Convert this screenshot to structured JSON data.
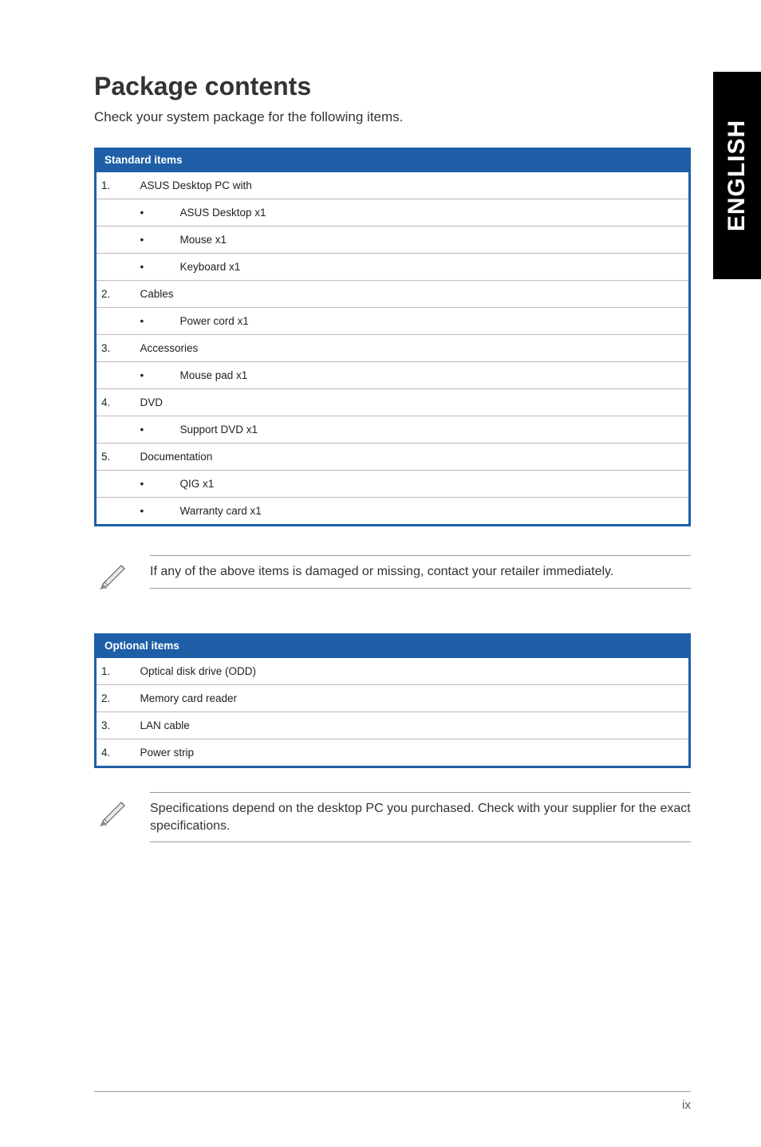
{
  "sideTab": "ENGLISH",
  "title": "Package contents",
  "intro": "Check your system package for the following items.",
  "standard": {
    "header": "Standard items",
    "rows": [
      {
        "n": "1.",
        "label": "ASUS Desktop PC with"
      },
      {
        "bullet": "•",
        "sub": "ASUS Desktop x1"
      },
      {
        "bullet": "•",
        "sub": "Mouse x1"
      },
      {
        "bullet": "•",
        "sub": "Keyboard x1"
      },
      {
        "n": "2.",
        "label": "Cables"
      },
      {
        "bullet": "•",
        "sub": "Power cord x1"
      },
      {
        "n": "3.",
        "label": "Accessories"
      },
      {
        "bullet": "•",
        "sub": "Mouse pad x1"
      },
      {
        "n": "4.",
        "label": "DVD"
      },
      {
        "bullet": "•",
        "sub": "Support DVD x1"
      },
      {
        "n": "5.",
        "label": "Documentation"
      },
      {
        "bullet": "•",
        "sub": "QIG x1"
      },
      {
        "bullet": "•",
        "sub": "Warranty card x1"
      }
    ]
  },
  "note1": "If any of the above items is damaged or missing, contact your retailer immediately.",
  "optional": {
    "header": "Optional items",
    "rows": [
      {
        "n": "1.",
        "label": "Optical disk drive (ODD)"
      },
      {
        "n": "2.",
        "label": "Memory card reader"
      },
      {
        "n": "3.",
        "label": "LAN cable"
      },
      {
        "n": "4.",
        "label": "Power strip"
      }
    ]
  },
  "note2": "Specifications depend on the desktop PC you purchased. Check with your supplier for the exact specifications.",
  "pageNumber": "ix"
}
